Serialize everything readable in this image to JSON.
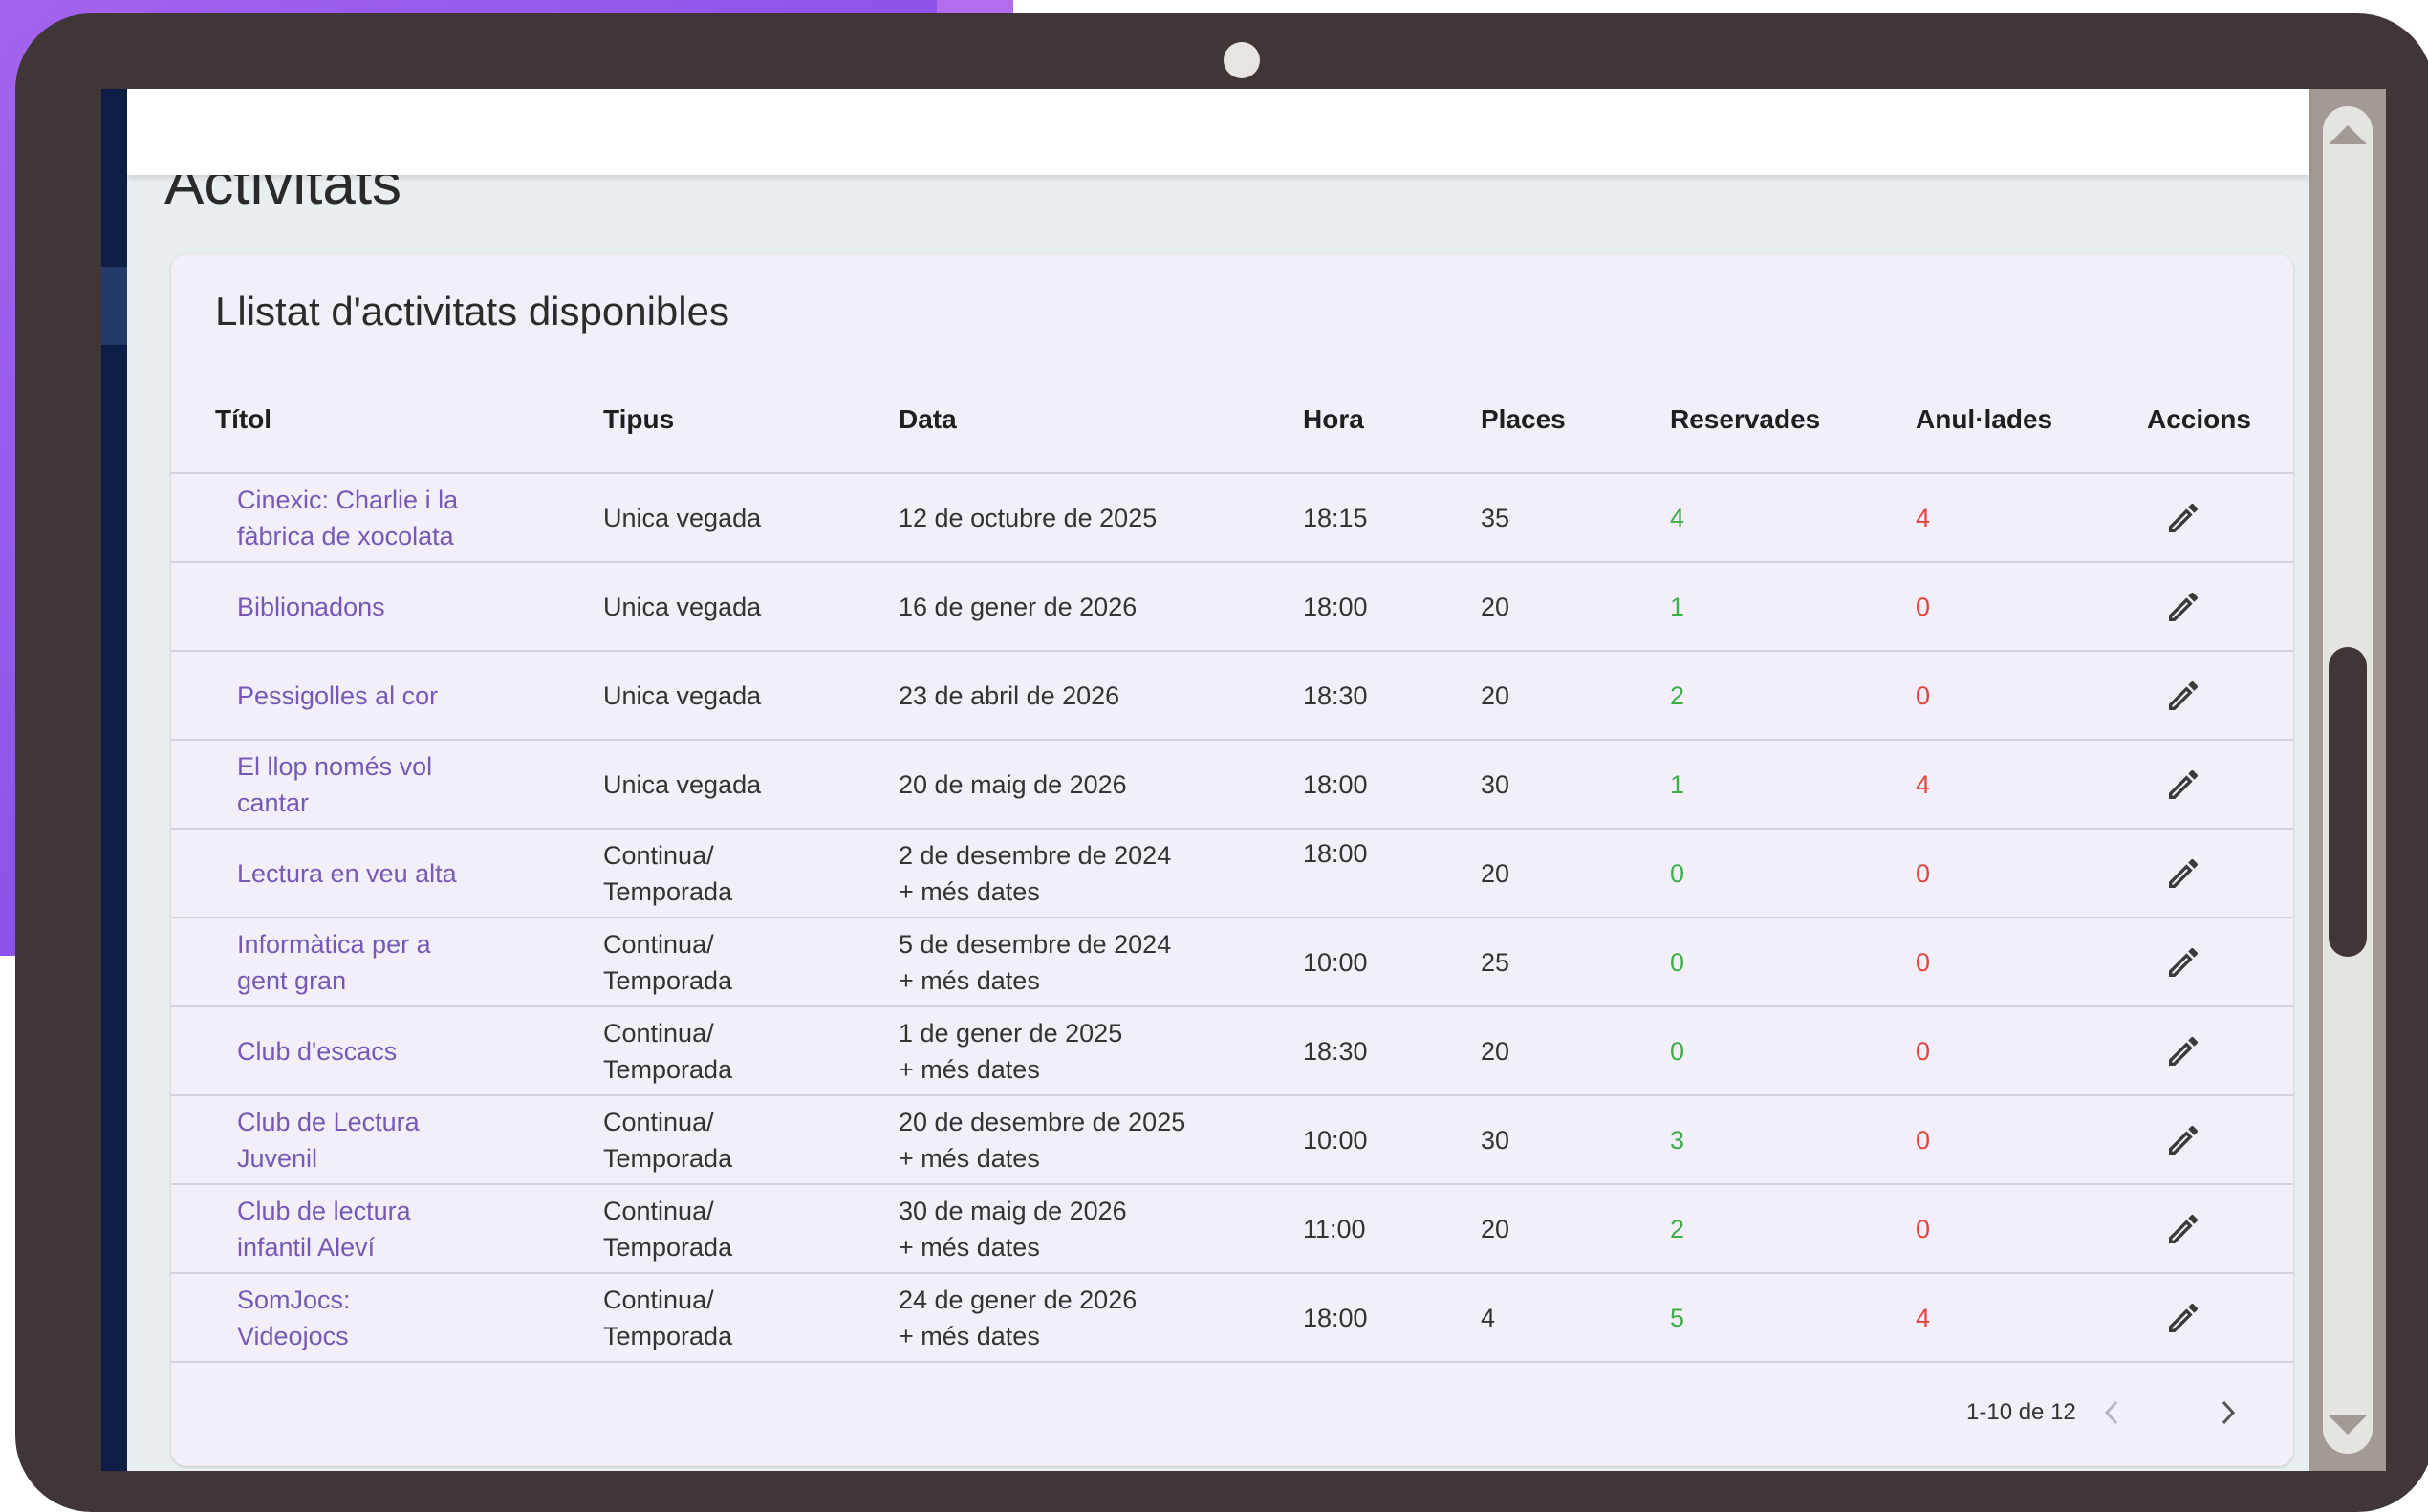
{
  "page": {
    "title": "Activitats"
  },
  "card": {
    "title": "Llistat d'activitats disponibles"
  },
  "columns": {
    "titol": "Títol",
    "tipus": "Tipus",
    "data": "Data",
    "hora": "Hora",
    "places": "Places",
    "reservades": "Reservades",
    "anulades": "Anul·lades",
    "accions": "Accions"
  },
  "rows": [
    {
      "titol": [
        "Cinexic: Charlie i la",
        "fàbrica de xocolata"
      ],
      "tipus": [
        "Unica vegada"
      ],
      "data": [
        "12 de octubre de 2025"
      ],
      "hora": "18:15",
      "places": "35",
      "reservades": "4",
      "anulades": "4"
    },
    {
      "titol": [
        "Biblionadons"
      ],
      "tipus": [
        "Unica vegada"
      ],
      "data": [
        "16 de gener de 2026"
      ],
      "hora": "18:00",
      "places": "20",
      "reservades": "1",
      "anulades": "0"
    },
    {
      "titol": [
        "Pessigolles al cor"
      ],
      "tipus": [
        "Unica vegada"
      ],
      "data": [
        "23 de abril de 2026"
      ],
      "hora": "18:30",
      "places": "20",
      "reservades": "2",
      "anulades": "0"
    },
    {
      "titol": [
        "El llop només vol",
        "cantar"
      ],
      "tipus": [
        "Unica vegada"
      ],
      "data": [
        "20 de maig de 2026"
      ],
      "hora": "18:00",
      "places": "30",
      "reservades": "1",
      "anulades": "4"
    },
    {
      "titol": [
        "Lectura en veu alta"
      ],
      "tipus": [
        "Continua/",
        "Temporada"
      ],
      "data": [
        "2 de desembre de 2024",
        "+ més dates"
      ],
      "hora": "18:00",
      "hora_top": true,
      "places": "20",
      "reservades": "0",
      "anulades": "0"
    },
    {
      "titol": [
        "Informàtica per a",
        "gent gran"
      ],
      "tipus": [
        "Continua/",
        "Temporada"
      ],
      "data": [
        "5 de desembre de 2024",
        "+ més dates"
      ],
      "hora": "10:00",
      "places": "25",
      "reservades": "0",
      "anulades": "0"
    },
    {
      "titol": [
        "Club d'escacs"
      ],
      "tipus": [
        "Continua/",
        "Temporada"
      ],
      "data": [
        "1 de gener de 2025",
        "+ més dates"
      ],
      "hora": "18:30",
      "places": "20",
      "reservades": "0",
      "anulades": "0"
    },
    {
      "titol": [
        "Club de Lectura",
        "Juvenil"
      ],
      "tipus": [
        "Continua/",
        "Temporada"
      ],
      "data": [
        "20 de desembre de 2025",
        "+ més dates"
      ],
      "hora": "10:00",
      "places": "30",
      "reservades": "3",
      "anulades": "0"
    },
    {
      "titol": [
        "Club de lectura",
        "infantil Aleví"
      ],
      "tipus": [
        "Continua/",
        "Temporada"
      ],
      "data": [
        "30 de maig de 2026",
        "+ més dates"
      ],
      "hora": "11:00",
      "places": "20",
      "reservades": "2",
      "anulades": "0"
    },
    {
      "titol": [
        "SomJocs:",
        "Videojocs"
      ],
      "tipus": [
        "Continua/",
        "Temporada"
      ],
      "data": [
        "24 de gener de 2026",
        "+ més dates"
      ],
      "hora": "18:00",
      "places": "4",
      "reservades": "5",
      "anulades": "4"
    }
  ],
  "row_actions": {
    "edit_icon": "pencil-icon"
  },
  "pagination": {
    "range_text": "1-10 de 12",
    "prev_icon": "chevron-left-icon",
    "next_icon": "chevron-right-icon"
  },
  "colors": {
    "title_link": "#7659b4",
    "reservades": "#3fae4a",
    "anulades": "#e5443c",
    "card_bg": "#f3eff9"
  }
}
